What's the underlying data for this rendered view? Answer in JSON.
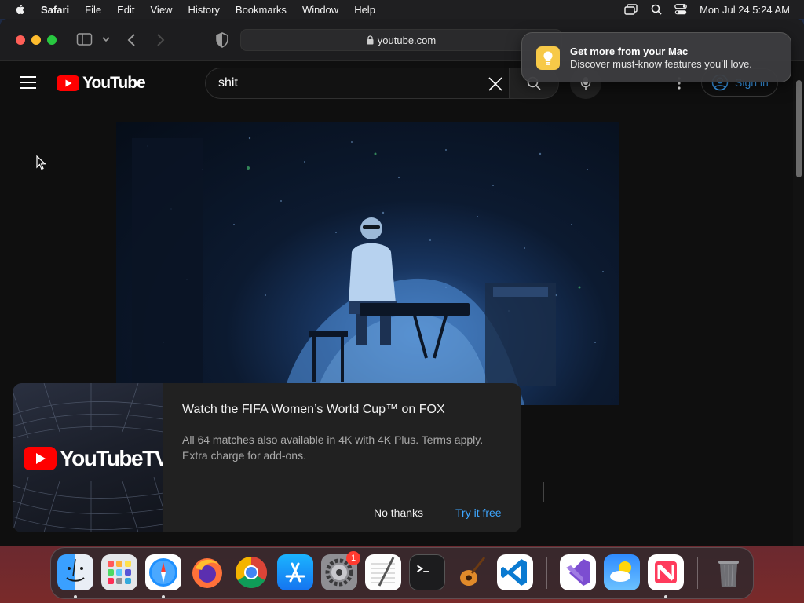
{
  "menubar": {
    "app_name": "Safari",
    "items": [
      "File",
      "Edit",
      "View",
      "History",
      "Bookmarks",
      "Window",
      "Help"
    ],
    "clock": "Mon Jul 24  5:24 AM"
  },
  "browser": {
    "url": "youtube.com"
  },
  "youtube": {
    "logo_text": "YouTube",
    "search_value": "shit",
    "sign_in_label": "Sign in"
  },
  "promo": {
    "logo_text": "YouTubeTV",
    "title": "Watch the FIFA Women’s World Cup™ on FOX",
    "description": "All 64 matches also available in 4K with 4K Plus. Terms apply. Extra charge for add-ons.",
    "no_thanks_label": "No thanks",
    "try_label": "Try it free"
  },
  "notification": {
    "title": "Get more from your Mac",
    "body": "Discover must-know features you’ll love."
  },
  "dock": {
    "apps": [
      "Finder",
      "Launchpad",
      "Safari",
      "Firefox",
      "Chrome",
      "App Store",
      "System Settings",
      "TextEdit",
      "Terminal",
      "GarageBand",
      "Visual Studio Code",
      "Visual Studio",
      "Weather",
      "News",
      "Trash"
    ],
    "settings_badge": "1"
  },
  "colors": {
    "youtube_red": "#ff0000",
    "link_blue": "#3ea6ff",
    "page_bg": "#0f0f0f"
  }
}
